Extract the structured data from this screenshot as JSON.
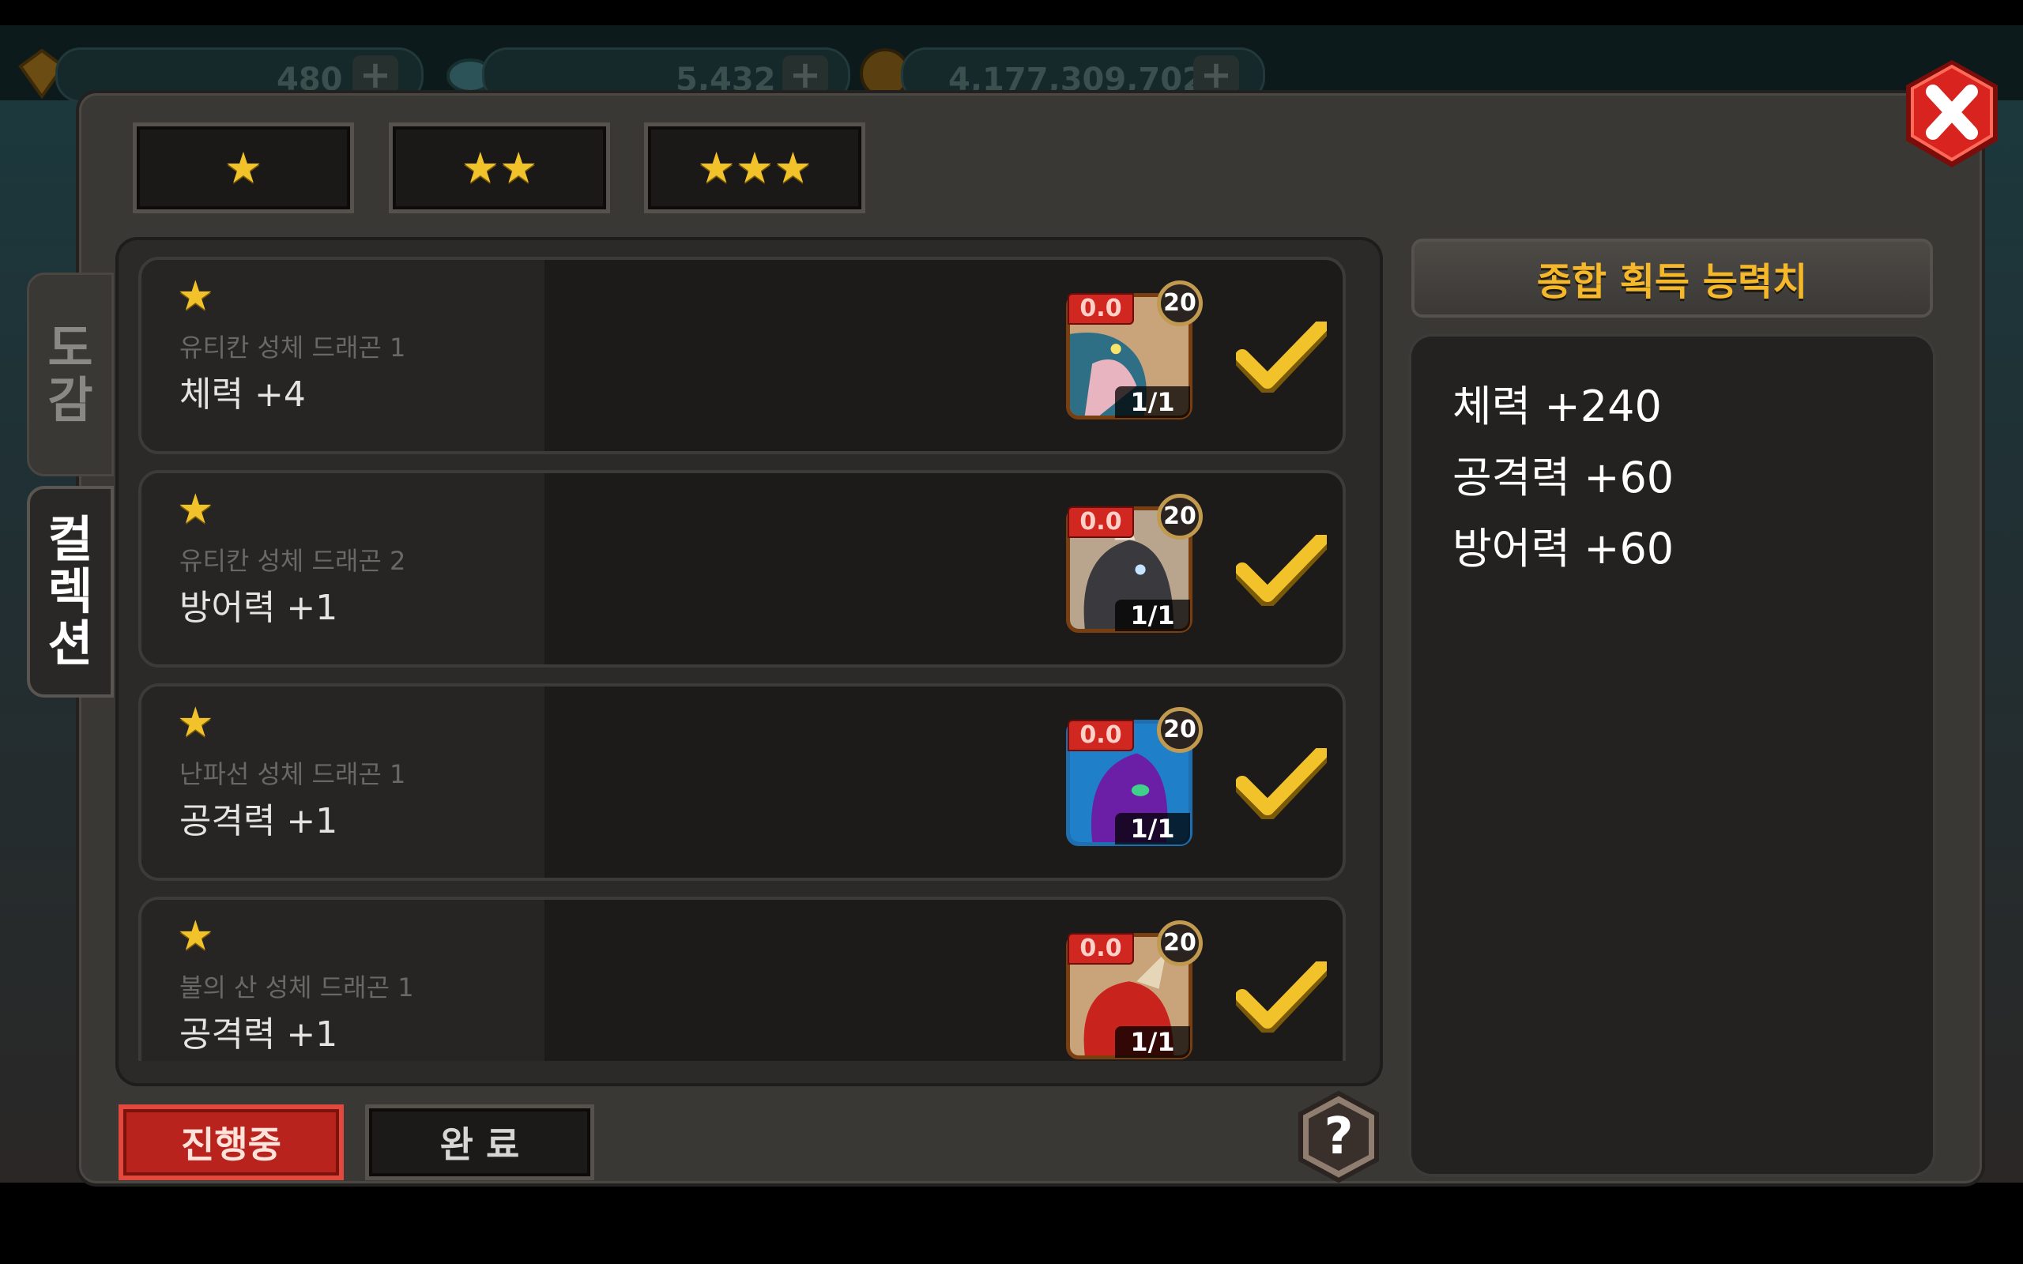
{
  "background": {
    "resources": [
      {
        "icon": "gem-icon",
        "value": "480"
      },
      {
        "icon": "crystal-icon",
        "value": "5,432"
      },
      {
        "icon": "gold-coin-icon",
        "value": "4,177,309,702"
      }
    ]
  },
  "filters": {
    "star_tabs": [
      {
        "stars": 1,
        "label": "★"
      },
      {
        "stars": 2,
        "label": "★★"
      },
      {
        "stars": 3,
        "label": "★★★"
      }
    ]
  },
  "side_tabs": {
    "dogam": [
      "도",
      "감"
    ],
    "collection": [
      "컬",
      "렉",
      "션"
    ]
  },
  "collection_items": [
    {
      "star": "★",
      "name": "유티칸 성체 드래곤 1",
      "stat": "체력 +4",
      "score": "0.0",
      "level": "20",
      "count": "1/1",
      "portrait": "blue-dragon",
      "completed": true
    },
    {
      "star": "★",
      "name": "유티칸 성체 드래곤 2",
      "stat": "방어력 +1",
      "score": "0.0",
      "level": "20",
      "count": "1/1",
      "portrait": "grey-dragon",
      "completed": true
    },
    {
      "star": "★",
      "name": "난파선 성체 드래곤 1",
      "stat": "공격력 +1",
      "score": "0.0",
      "level": "20",
      "count": "1/1",
      "portrait": "purple-dragon",
      "completed": true
    },
    {
      "star": "★",
      "name": "불의 산 성체 드래곤 1",
      "stat": "공격력 +1",
      "score": "0.0",
      "level": "20",
      "count": "1/1",
      "portrait": "red-dragon",
      "completed": true
    }
  ],
  "summary": {
    "title": "종합 획득 능력치",
    "lines": [
      "체력 +240",
      "공격력 +60",
      "방어력 +60"
    ]
  },
  "bottom": {
    "in_progress_label": "진행중",
    "completed_label": "완 료"
  },
  "colors": {
    "accent_gold": "#f5b82a",
    "active_red": "#b8241d",
    "close_red": "#d8231f"
  }
}
